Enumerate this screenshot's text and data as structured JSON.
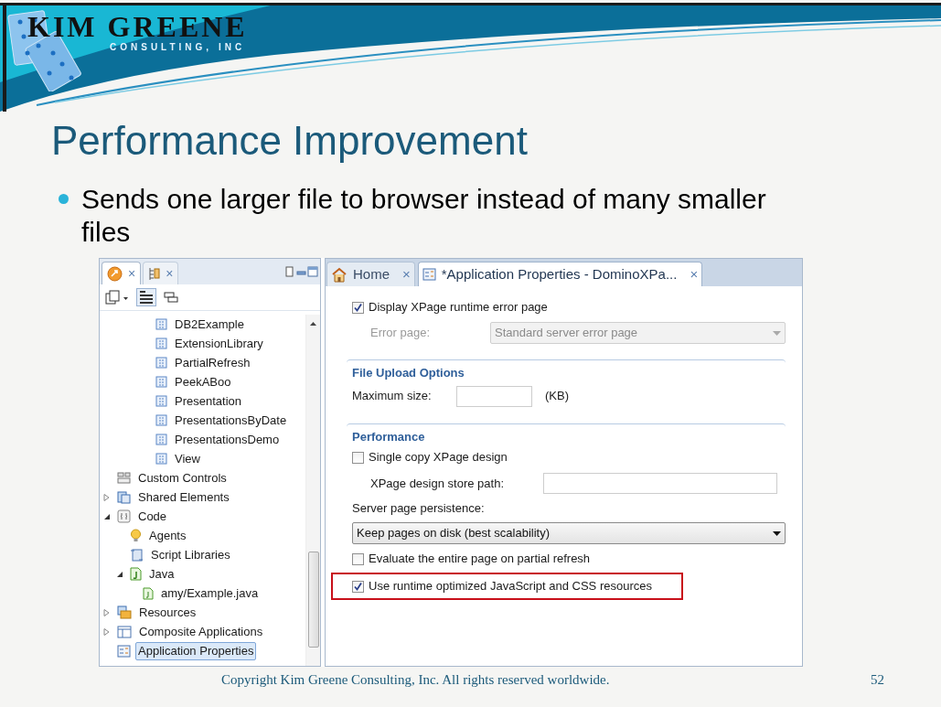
{
  "header": {
    "logo_title": "KIM GREENE",
    "logo_subtitle": "CONSULTING, INC"
  },
  "slide": {
    "title": "Performance Improvement",
    "bullets": [
      "Sends one larger file to browser instead of many smaller files"
    ]
  },
  "ide": {
    "left_tabs": [
      {
        "kind": "designer",
        "close": "×",
        "selected": true
      },
      {
        "kind": "outline",
        "close": "×",
        "selected": false
      }
    ],
    "tree": {
      "continued_items": [
        {
          "label": "DB2Example",
          "kind": "view",
          "selected": false
        },
        {
          "label": "ExtensionLibrary",
          "kind": "view",
          "selected": false
        },
        {
          "label": "PartialRefresh",
          "kind": "view",
          "selected": false
        },
        {
          "label": "PeekABoo",
          "kind": "view",
          "selected": false
        },
        {
          "label": "Presentation",
          "kind": "view",
          "selected": false
        },
        {
          "label": "PresentationsByDate",
          "kind": "view",
          "selected": false
        },
        {
          "label": "PresentationsDemo",
          "kind": "view",
          "selected": false
        },
        {
          "label": "View",
          "kind": "view",
          "selected": false
        }
      ],
      "items": [
        {
          "label": "Custom Controls",
          "kind": "controls",
          "selected": false
        },
        {
          "label": "Shared Elements",
          "kind": "shared",
          "expanded": false,
          "selected": false
        },
        {
          "label": "Code",
          "kind": "code",
          "expanded": true,
          "selected": false,
          "children": [
            {
              "label": "Agents",
              "kind": "agent",
              "selected": false
            },
            {
              "label": "Script Libraries",
              "kind": "script",
              "selected": false
            },
            {
              "label": "Java",
              "kind": "java",
              "expanded": true,
              "selected": false,
              "children": [
                {
                  "label": "amy/Example.java",
                  "kind": "javafile",
                  "selected": false
                }
              ]
            }
          ]
        },
        {
          "label": "Resources",
          "kind": "resources",
          "expanded": false,
          "selected": false
        },
        {
          "label": "Composite Applications",
          "kind": "composite",
          "expanded": false,
          "selected": false
        },
        {
          "label": "Application Properties",
          "kind": "properties",
          "selected": true
        }
      ]
    },
    "editor_tabs": [
      {
        "label": "Home",
        "kind": "home",
        "close": "×",
        "selected": false
      },
      {
        "label": "*Application Properties - DominoXPa...",
        "kind": "properties",
        "close": "×",
        "selected": true
      }
    ],
    "form": [
      {
        "kind": "checkbox",
        "label": "Display XPage runtime error page",
        "checked": true,
        "highlighted": false
      },
      {
        "kind": "select",
        "label": "Error page:",
        "value": "Standard server error page",
        "disabled": true
      },
      {
        "kind": "section",
        "label": "File Upload Options"
      },
      {
        "kind": "field",
        "label": "Maximum size:",
        "unit": "(KB)",
        "indented": false
      },
      {
        "kind": "section",
        "label": "Performance"
      },
      {
        "kind": "checkbox",
        "label": "Single copy XPage design",
        "checked": false,
        "highlighted": false
      },
      {
        "kind": "field",
        "label": "XPage design store path:",
        "indented": true
      },
      {
        "kind": "label",
        "label": "Server page persistence:"
      },
      {
        "kind": "select",
        "value": "Keep pages on disk (best scalability)",
        "disabled": false
      },
      {
        "kind": "checkbox",
        "label": "Evaluate the entire page on partial refresh",
        "checked": false,
        "highlighted": false
      },
      {
        "kind": "checkbox",
        "label": "Use runtime optimized JavaScript and CSS resources",
        "checked": true,
        "highlighted": true
      }
    ]
  },
  "footer": {
    "copyright": "Copyright Kim Greene Consulting, Inc.  All rights reserved worldwide.",
    "page_number": "52"
  }
}
